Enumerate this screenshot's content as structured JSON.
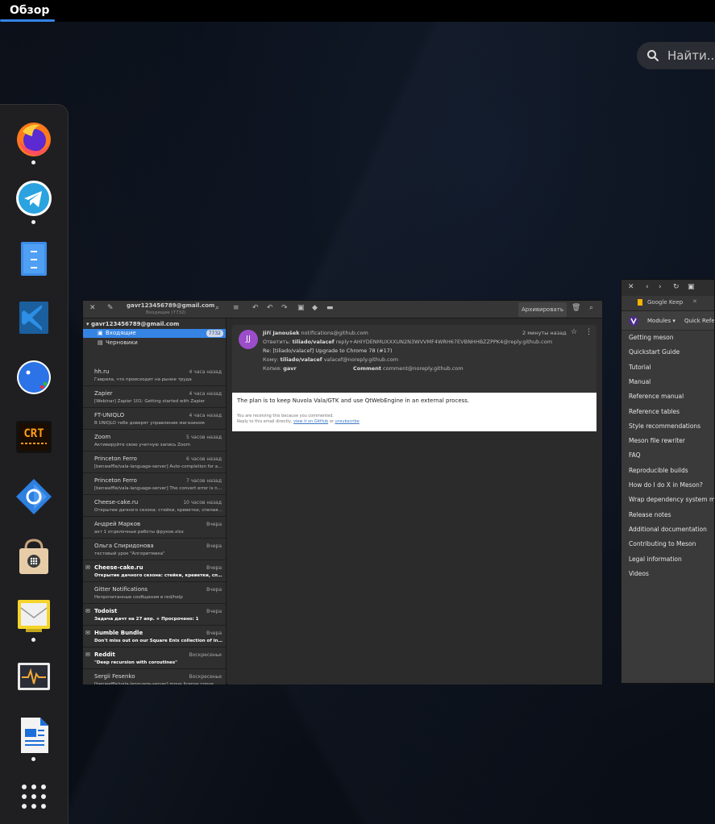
{
  "topbar": {
    "activities": "Обзор"
  },
  "search": {
    "placeholder": "Найти..."
  },
  "dash": {
    "apps": [
      {
        "name": "firefox-icon",
        "running": true
      },
      {
        "name": "telegram-icon",
        "running": true
      },
      {
        "name": "file-cabinet-icon",
        "running": false
      },
      {
        "name": "vscode-icon",
        "running": false
      },
      {
        "name": "bluetooth-app-icon",
        "running": false
      },
      {
        "name": "crt-terminal-icon",
        "running": false
      },
      {
        "name": "update-manager-icon",
        "running": false
      },
      {
        "name": "software-store-icon",
        "running": false
      },
      {
        "name": "mail-client-icon",
        "running": true
      },
      {
        "name": "system-monitor-icon",
        "running": false
      },
      {
        "name": "writer-document-icon",
        "running": true
      },
      {
        "name": "app-grid-icon",
        "running": false
      }
    ]
  },
  "mail": {
    "header_account": "gavr123456789@gmail.com",
    "header_sub": "Входящие (7732)",
    "archive_label": "Архивировать",
    "account": "gavr123456789@gmail.com",
    "folders": [
      {
        "label": "Входящие",
        "count": "7732",
        "selected": true
      },
      {
        "label": "Черновики",
        "count": "",
        "selected": false
      }
    ],
    "messages": [
      {
        "from": "hh.ru",
        "when": "4 часа назад",
        "subject": "Гаврила, что происходит на рынке труда",
        "unread": false
      },
      {
        "from": "Zapier",
        "when": "4 часа назад",
        "subject": "[Webinar] Zapier 101: Getting started with Zapier",
        "unread": false
      },
      {
        "from": "FT-UNIQLO",
        "when": "4 часа назад",
        "subject": "В UNIQLO тебе доверят управление магазином",
        "unread": false
      },
      {
        "from": "Zoom",
        "when": "5 часов назад",
        "subject": "Активируйте свою учетную запись Zoom",
        "unread": false
      },
      {
        "from": "Princeton Ferro",
        "when": "6 часов назад",
        "subject": "[benwaffle/vala-language-server] Auto-completion for ar...",
        "unread": false
      },
      {
        "from": "Princeton Ferro",
        "when": "7 часов назад",
        "subject": "[benwaffle/vala-language-server] The convert error is no...",
        "unread": false
      },
      {
        "from": "Cheese-cake.ru",
        "when": "10 часов назад",
        "subject": "Открытие дачного сезона: стейки, креветки, спелая ма...",
        "unread": false
      },
      {
        "from": "Андрей Марков",
        "when": "Вчера",
        "subject": "акт 1 отделочные работы фрукое.xlsx",
        "unread": false
      },
      {
        "from": "Ольга Спиридонова",
        "when": "Вчера",
        "subject": "тестовый урок \"Алгоритмика\"",
        "unread": false
      },
      {
        "from": "Cheese-cake.ru",
        "when": "Вчера",
        "subject": "Открытие дачного сезона: стейки, креветки, спелая м...",
        "unread": true
      },
      {
        "from": "Gitter Notifications",
        "when": "Вчера",
        "subject": "Непрочитанные сообщения в red/help",
        "unread": false
      },
      {
        "from": "Todoist",
        "when": "Вчера",
        "subject": "Задача дачт на 27 апр. + Просрочено: 1",
        "unread": true
      },
      {
        "from": "Humble Bundle",
        "when": "Вчера",
        "subject": "Don't miss out on our Square Enix collection of indie ga...",
        "unread": true
      },
      {
        "from": "Reddit",
        "when": "Воскресенье",
        "subject": "\"Deep recursion with coroutines\"",
        "unread": true
      },
      {
        "from": "Sergii Fesenko",
        "when": "Воскресенье",
        "subject": "[benwaffle/vala-language-server] move license conve...",
        "unread": false
      }
    ],
    "view": {
      "avatar_initials": "JJ",
      "sender": "Jiří Janoušek",
      "sender_email": "notifications@github.com",
      "time": "2 минуты назад",
      "reply_to_label": "Ответить:",
      "reply_to": "tiliado/valacef",
      "reply_to_addr": "reply+AHIYDENMUXXXUN2N3WVVMF4WRH67EVBNHHBZZPPK4@reply.github.com",
      "subject": "Re: [tiliado/valacef] Upgrade to Chrome 78 (#17)",
      "to_label": "Кому:",
      "to": "tiliado/valacef",
      "to_addr": "valacef@noreply.github.com",
      "cc_label": "Копия:",
      "cc": "gavr",
      "comment_label": "Comment",
      "comment_addr": "comment@noreply.github.com",
      "body": "The plan is to keep Nuvola Vala/GTK and use QtWebEngine in an external process.",
      "footer1": "You are receiving this because you commented.",
      "footer2": "Reply to this email directly,",
      "footer_link1": "view it on GitHub",
      "footer_or": "or",
      "footer_link2": "unsubscribe"
    }
  },
  "docs": {
    "tab": "Google Keep",
    "modules": "Modules",
    "quick_ref": "Quick Refere",
    "links": [
      "Getting meson",
      "Quickstart Guide",
      "Tutorial",
      "Manual",
      "Reference manual",
      "Reference tables",
      "Style recommendations",
      "Meson file rewriter",
      "FAQ",
      "Reproducible builds",
      "How do I do X in Meson?",
      "Wrap dependency system manu",
      "Release notes",
      "Additional documentation",
      "Contributing to Meson",
      "Legal information",
      "Videos"
    ]
  },
  "colors": {
    "accent": "#3584e4",
    "avatar": "#9b4dca"
  }
}
